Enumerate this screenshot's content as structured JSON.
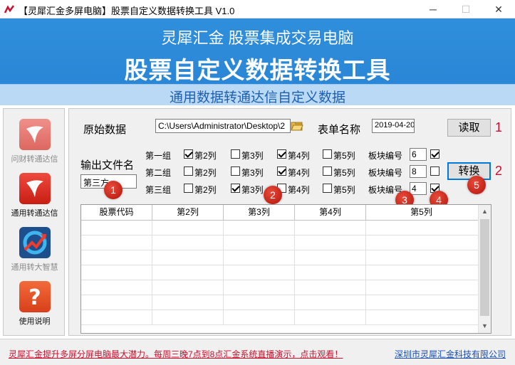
{
  "window": {
    "title": "【灵犀汇金多屏电脑】股票自定义数据转换工具 V1.0",
    "minimize_glyph": "─",
    "maximize_glyph": "☐",
    "close_glyph": "✕"
  },
  "banner": {
    "subtitle": "灵犀汇金  股票集成交易电脑",
    "title": "股票自定义数据转换工具",
    "strip": "通用数据转通达信自定义数据"
  },
  "sidebar": {
    "items": [
      {
        "label": "问财转通达信",
        "icon": "tdx-logo-icon",
        "enabled": false
      },
      {
        "label": "通用转通达信",
        "icon": "tdx-logo-icon",
        "enabled": true
      },
      {
        "label": "通用转大智慧",
        "icon": "dzh-logo-icon",
        "enabled": false
      },
      {
        "label": "使用说明",
        "icon": "help-question-icon",
        "enabled": true
      }
    ]
  },
  "form": {
    "source_label": "原始数据",
    "source_path": "C:\\Users\\Administrator\\Desktop\\2",
    "sheet_label": "表单名称",
    "sheet_value": "2019-04-20",
    "read_button": "读取",
    "read_marker": "1",
    "output_label": "输出文件名",
    "output_value": "第三方",
    "convert_button": "转换",
    "convert_marker": "2",
    "block_label": "板块编号",
    "groups": [
      {
        "name": "第一组",
        "cols": [
          {
            "label": "第2列",
            "checked": true
          },
          {
            "label": "第3列",
            "checked": false
          },
          {
            "label": "第4列",
            "checked": true
          },
          {
            "label": "第5列",
            "checked": false
          }
        ],
        "block_no": "6",
        "enabled": true
      },
      {
        "name": "第二组",
        "cols": [
          {
            "label": "第2列",
            "checked": false
          },
          {
            "label": "第3列",
            "checked": false
          },
          {
            "label": "第4列",
            "checked": true
          },
          {
            "label": "第5列",
            "checked": false
          }
        ],
        "block_no": "8",
        "enabled": false
      },
      {
        "name": "第三组",
        "cols": [
          {
            "label": "第2列",
            "checked": false
          },
          {
            "label": "第3列",
            "checked": true
          },
          {
            "label": "第4列",
            "checked": false
          },
          {
            "label": "第5列",
            "checked": false
          }
        ],
        "block_no": "4",
        "enabled": true
      }
    ]
  },
  "badges": [
    "1",
    "2",
    "3",
    "4",
    "5"
  ],
  "grid": {
    "headers": [
      "股票代码",
      "第2列",
      "第3列",
      "第4列",
      "第5列"
    ],
    "rows": 7,
    "scroll_up": "▲",
    "scroll_down": "▼"
  },
  "footer": {
    "promo": "灵犀汇金提升多屏分屏电脑最大潜力。每周三晚7点到8点汇金系统直播演示，点击观看！",
    "company": "深圳市灵犀汇金科技有限公司"
  },
  "colors": {
    "banner_blue": "#2f8fdc",
    "strip_blue": "#b9d9f5",
    "accent_red": "#c8102e",
    "link_blue": "#1a4fb4"
  }
}
